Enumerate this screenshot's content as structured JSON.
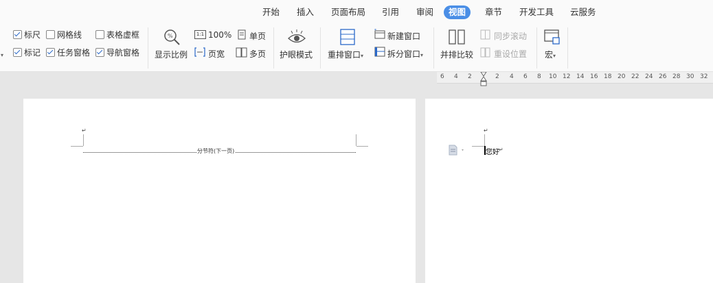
{
  "menu": {
    "tabs": [
      "开始",
      "插入",
      "页面布局",
      "引用",
      "审阅",
      "视图",
      "章节",
      "开发工具",
      "云服务"
    ],
    "active": "视图"
  },
  "ribbon": {
    "show": {
      "ruler": "标尺",
      "gridlines": "网格线",
      "table_gridlines": "表格虚框",
      "marks": "标记",
      "task_pane": "任务窗格",
      "nav_pane": "导航窗格"
    },
    "zoom": {
      "display_ratio": "显示比例",
      "hundred": "100%",
      "page_width": "页宽",
      "single_page": "单页",
      "multi_page": "多页"
    },
    "eye_mode": "护眼模式",
    "window": {
      "rearrange": "重排窗口",
      "new_window": "新建窗口",
      "split_window": "拆分窗口",
      "side_by_side": "并排比较",
      "sync_scroll": "同步滚动",
      "reset_position": "重设位置"
    },
    "macro": "宏"
  },
  "ruler_ticks": [
    "6",
    "4",
    "2",
    "2",
    "4",
    "6",
    "8",
    "10",
    "12",
    "14",
    "16",
    "18",
    "20",
    "22",
    "24",
    "26",
    "28",
    "30",
    "32"
  ],
  "document": {
    "section_break": "分节符(下一页)",
    "page2_text": "您好"
  }
}
